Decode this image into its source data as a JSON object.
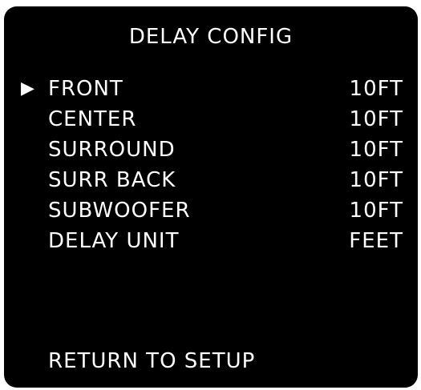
{
  "menu": {
    "title": "DELAY CONFIG",
    "cursor_icon": "right-triangle-icon",
    "items": [
      {
        "label": "FRONT",
        "value": "10FT",
        "selected": true
      },
      {
        "label": "CENTER",
        "value": "10FT"
      },
      {
        "label": "SURROUND",
        "value": "10FT"
      },
      {
        "label": "SURR BACK",
        "value": "10FT"
      },
      {
        "label": "SUBWOOFER",
        "value": "10FT"
      },
      {
        "label": "DELAY UNIT",
        "value": "FEET"
      }
    ],
    "return_label": "RETURN TO SETUP"
  },
  "colors": {
    "background": "#000000",
    "text": "#ffffff"
  }
}
